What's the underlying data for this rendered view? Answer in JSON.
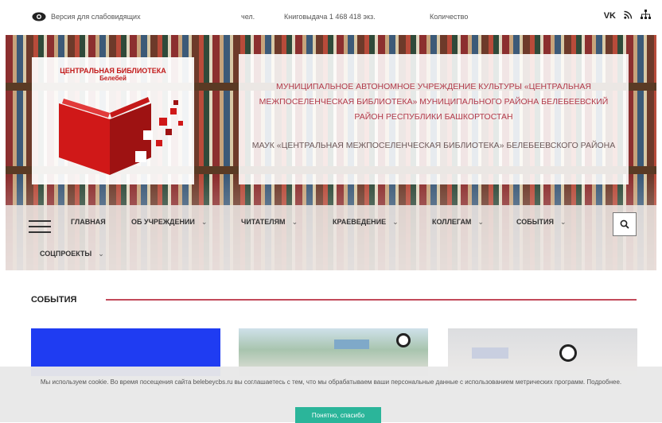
{
  "topbar": {
    "vision_label": "Версия для слабовидящих",
    "vision_icon": "eye-icon",
    "stat_readers": "чел.",
    "stat_books": "Книговыдача 1 468 418 экз.",
    "stat_count": "Количество",
    "social": {
      "vk": "VK",
      "rss_icon": "rss-icon",
      "sitemap_icon": "sitemap-icon"
    }
  },
  "logo": {
    "title_line1": "ЦЕНТРАЛЬНАЯ БИБЛИОТЕКА",
    "title_line2": "Белебей",
    "colors": {
      "primary": "#c21a1a",
      "dark": "#8e1010"
    }
  },
  "header": {
    "full_name": "МУНИЦИПАЛЬНОЕ АВТОНОМНОЕ УЧРЕЖДЕНИЕ КУЛЬТУРЫ «ЦЕНТРАЛЬНАЯ МЕЖПОСЕЛЕНЧЕСКАЯ БИБЛИОТЕКА» МУНИЦИПАЛЬНОГО РАЙОНА БЕЛЕБЕЕВСКИЙ РАЙОН РЕСПУБЛИКИ БАШКОРТОСТАН",
    "short_name": "МАУК «ЦЕНТРАЛЬНАЯ МЕЖПОСЕЛЕНЧЕСКАЯ БИБЛИОТЕКА» БЕЛЕБЕЕВСКОГО РАЙОНА"
  },
  "nav": {
    "menu_icon": "hamburger-icon",
    "items": [
      {
        "label": "Главная",
        "has_dropdown": false
      },
      {
        "label": "Об учреждении",
        "has_dropdown": true
      },
      {
        "label": "Читателям",
        "has_dropdown": true
      },
      {
        "label": "Краеведение",
        "has_dropdown": true
      },
      {
        "label": "Коллегам",
        "has_dropdown": true
      },
      {
        "label": "События",
        "has_dropdown": true
      },
      {
        "label": "Соцпроекты",
        "has_dropdown": true
      }
    ],
    "chevron": "⌄",
    "search_icon": "search-icon"
  },
  "events": {
    "heading": "События",
    "accent_color": "#c34a5a"
  },
  "cookie": {
    "text": "Мы используем cookie. Во время посещения сайта belebeycbs.ru вы соглашаетесь с тем, что мы обрабатываем ваши персональные данные с использованием метрических программ. Подробнее.",
    "button": "Понятно, спасибо",
    "button_color": "#2bb59a"
  }
}
